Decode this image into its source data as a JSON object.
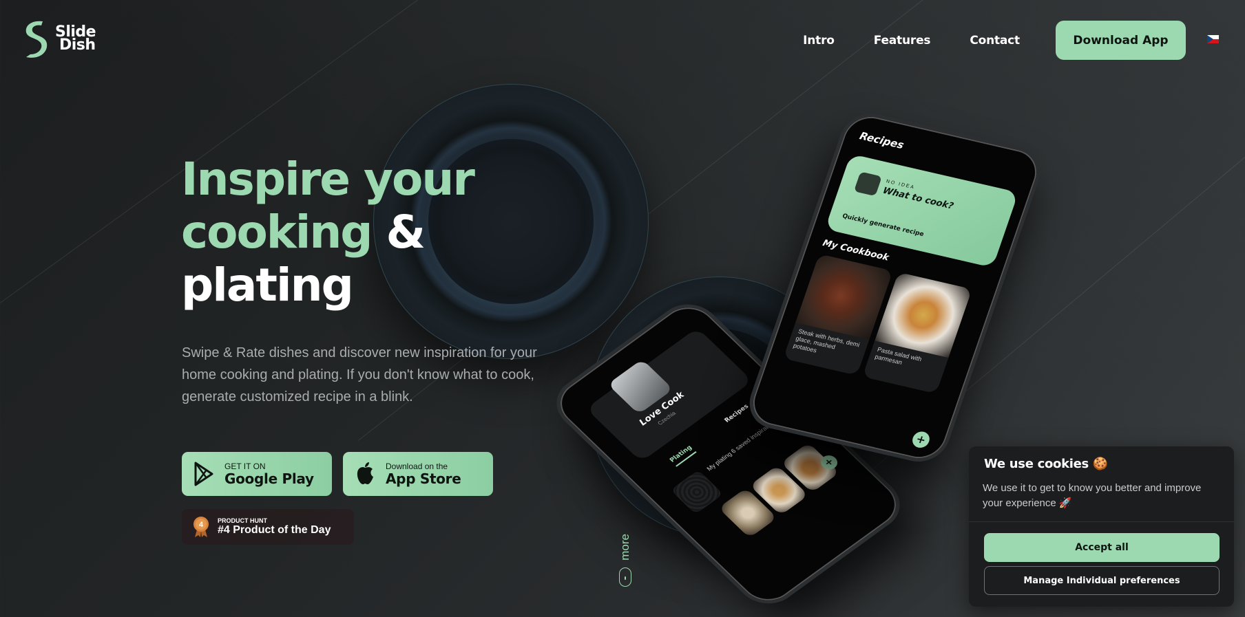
{
  "brand": {
    "name_line1": "Slide",
    "name_line2": "Dish",
    "accent_color": "#9dd9b0"
  },
  "nav": {
    "links": [
      "Intro",
      "Features",
      "Contact"
    ],
    "cta": "Download App",
    "language_icon": "czech-flag-icon"
  },
  "hero": {
    "title_line1": "Inspire your",
    "title_line2_accent": "cooking",
    "title_line2_rest": " &",
    "title_line3": "plating",
    "subtitle": "Swipe & Rate dishes and discover new inspiration for your home cooking and plating. If you don't know what to cook, generate customized recipe in a blink.",
    "google_play": {
      "small": "GET IT ON",
      "big": "Google Play",
      "icon": "google-play-icon"
    },
    "app_store": {
      "small": "Download on the",
      "big": "App Store",
      "icon": "apple-icon"
    },
    "product_hunt": {
      "rank": "4",
      "small": "PRODUCT HUNT",
      "big": "#4 Product of the Day"
    }
  },
  "scroll_hint": "more",
  "phone_recipes": {
    "title": "Recipes",
    "card_kicker": "NO IDEA",
    "card_question": "What to cook?",
    "card_sub": "Quickly generate recipe",
    "section": "My Cookbook",
    "dishes": [
      "Steak with herbs, demi glace, mashed potatoes",
      "Pasta salad with parmesan"
    ]
  },
  "phone_profile": {
    "name": "Love Cook",
    "location": "Czechia",
    "tabs": [
      "Plating",
      "Recipes"
    ],
    "note": "My plating 6 saved inspiration"
  },
  "cookie": {
    "title": "We use cookies 🍪",
    "text": "We use it to get to know you better and improve your experience 🚀",
    "accept": "Accept all",
    "manage": "Manage Individual preferences"
  }
}
